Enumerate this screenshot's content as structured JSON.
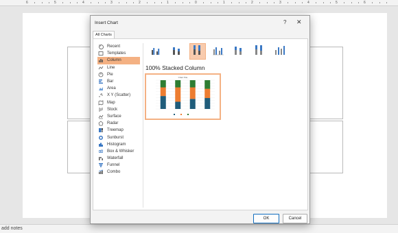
{
  "ruler": {
    "labels": [
      "6",
      "5",
      "4",
      "3",
      "2",
      "1",
      "0",
      "1",
      "2",
      "3",
      "4",
      "5",
      "6"
    ]
  },
  "dialog": {
    "title": "Insert Chart",
    "help_glyph": "?",
    "close_glyph": "✕",
    "tabs": [
      {
        "label": "All Charts"
      }
    ],
    "categories": [
      {
        "label": "Recent",
        "icon": "recent-icon"
      },
      {
        "label": "Templates",
        "icon": "templates-icon"
      },
      {
        "label": "Column",
        "icon": "column-chart-icon",
        "selected": true
      },
      {
        "label": "Line",
        "icon": "line-chart-icon"
      },
      {
        "label": "Pie",
        "icon": "pie-chart-icon"
      },
      {
        "label": "Bar",
        "icon": "bar-chart-icon"
      },
      {
        "label": "Area",
        "icon": "area-chart-icon"
      },
      {
        "label": "X Y (Scatter)",
        "icon": "scatter-chart-icon"
      },
      {
        "label": "Map",
        "icon": "map-chart-icon"
      },
      {
        "label": "Stock",
        "icon": "stock-chart-icon"
      },
      {
        "label": "Surface",
        "icon": "surface-chart-icon"
      },
      {
        "label": "Radar",
        "icon": "radar-chart-icon"
      },
      {
        "label": "Treemap",
        "icon": "treemap-chart-icon"
      },
      {
        "label": "Sunburst",
        "icon": "sunburst-chart-icon"
      },
      {
        "label": "Histogram",
        "icon": "histogram-chart-icon"
      },
      {
        "label": "Box & Whisker",
        "icon": "box-whisker-chart-icon"
      },
      {
        "label": "Waterfall",
        "icon": "waterfall-chart-icon"
      },
      {
        "label": "Funnel",
        "icon": "funnel-chart-icon"
      },
      {
        "label": "Combo",
        "icon": "combo-chart-icon"
      }
    ],
    "subtypes": [
      {
        "icon": "clustered-column-icon"
      },
      {
        "icon": "stacked-column-icon"
      },
      {
        "icon": "100-stacked-column-icon",
        "selected": true
      },
      {
        "icon": "3d-clustered-column-icon"
      },
      {
        "icon": "3d-stacked-column-icon"
      },
      {
        "icon": "3d-100-stacked-column-icon"
      },
      {
        "icon": "3d-column-icon"
      }
    ],
    "selected_subtype_title": "100% Stacked Column",
    "preview": {
      "title": "Chart Title",
      "series_colors": [
        "#1f5c7a",
        "#ed7d31",
        "#2e7d32"
      ],
      "columns": [
        [
          45,
          30,
          25
        ],
        [
          25,
          50,
          25
        ],
        [
          35,
          40,
          25
        ],
        [
          38,
          32,
          30
        ]
      ]
    },
    "ok_label": "OK",
    "cancel_label": "Cancel"
  },
  "notes": {
    "placeholder": "add notes"
  },
  "colors": {
    "accent_selected": "#f4b183",
    "ok_border": "#0f6cbd"
  }
}
